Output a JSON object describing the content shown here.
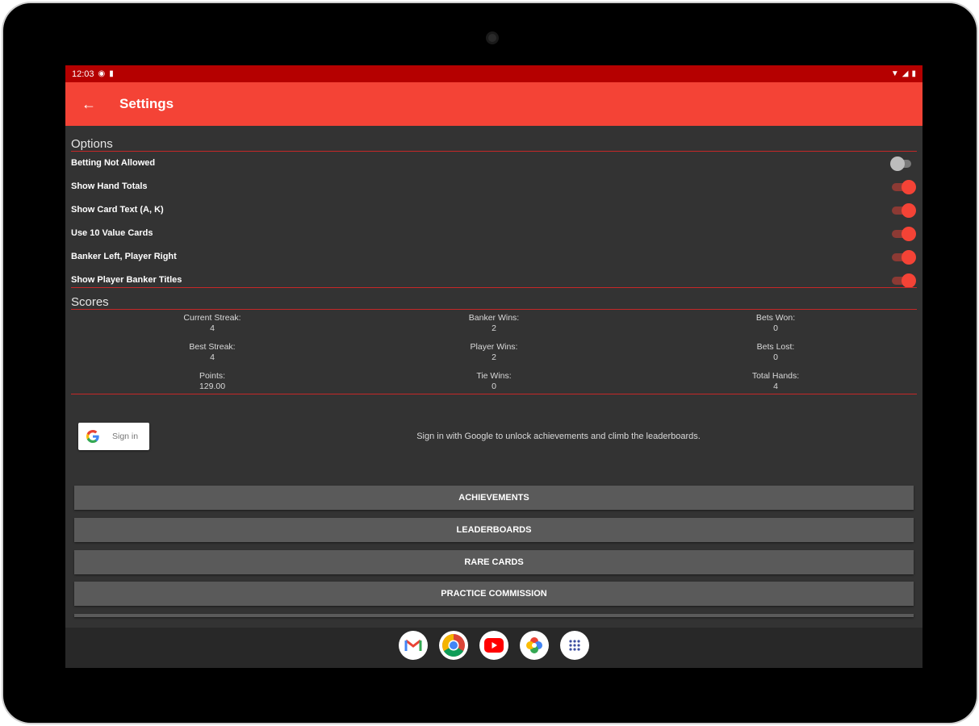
{
  "status_bar": {
    "time": "12:03"
  },
  "app_bar": {
    "title": "Settings"
  },
  "options": {
    "title": "Options",
    "items": [
      {
        "label": "Betting Not Allowed",
        "enabled": false
      },
      {
        "label": "Show Hand Totals",
        "enabled": true
      },
      {
        "label": "Show Card Text (A, K)",
        "enabled": true
      },
      {
        "label": "Use 10 Value Cards",
        "enabled": true
      },
      {
        "label": "Banker Left, Player Right",
        "enabled": true
      },
      {
        "label": "Show Player Banker Titles",
        "enabled": true
      }
    ]
  },
  "scores": {
    "title": "Scores",
    "items": [
      {
        "label": "Current Streak:",
        "value": "4"
      },
      {
        "label": "Banker Wins:",
        "value": "2"
      },
      {
        "label": "Bets Won:",
        "value": "0"
      },
      {
        "label": "Best Streak:",
        "value": "4"
      },
      {
        "label": "Player Wins:",
        "value": "2"
      },
      {
        "label": "Bets Lost:",
        "value": "0"
      },
      {
        "label": "Points:",
        "value": "129.00"
      },
      {
        "label": "Tie Wins:",
        "value": "0"
      },
      {
        "label": "Total Hands:",
        "value": "4"
      }
    ]
  },
  "google_signin": {
    "button_label": "Sign in",
    "message": "Sign in with Google to unlock achievements and climb the leaderboards."
  },
  "buttons": {
    "achievements": "ACHIEVEMENTS",
    "leaderboards": "LEADERBOARDS",
    "rare_cards": "RARE CARDS",
    "practice_commission": "PRACTICE COMMISSION"
  },
  "colors": {
    "status_bar": "#b50000",
    "app_bar": "#f44336",
    "background": "#333333",
    "accent": "#f44336"
  },
  "dock": {
    "apps": [
      "gmail-icon",
      "chrome-icon",
      "youtube-icon",
      "photos-icon",
      "app-launcher-icon"
    ]
  }
}
